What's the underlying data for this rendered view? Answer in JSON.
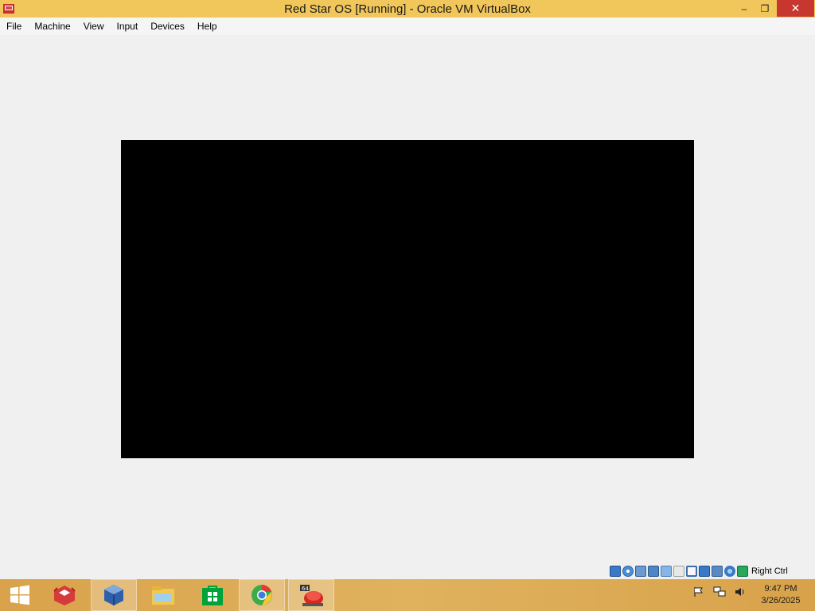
{
  "window": {
    "title": "Red Star OS [Running] - Oracle VM VirtualBox",
    "minimize_label": "–",
    "maximize_label": "❐",
    "close_label": "✕"
  },
  "menu": {
    "items": [
      "File",
      "Machine",
      "View",
      "Input",
      "Devices",
      "Help"
    ]
  },
  "statusbar": {
    "icons": [
      "hard-disk-icon",
      "optical-drive-icon",
      "audio-icon",
      "network-icon",
      "usb-icon",
      "shared-folders-icon",
      "display-icon",
      "video-capture-icon",
      "mouse-integration-icon",
      "cpu-icon",
      "host-key-icon"
    ],
    "host_key": "Right Ctrl"
  },
  "taskbar": {
    "apps": [
      "start-icon",
      "app-icon-red",
      "virtualbox-icon",
      "file-explorer-icon",
      "store-icon",
      "chrome-icon",
      "red-star-vm-icon"
    ],
    "tray_icons": [
      "flag-icon",
      "network-icon",
      "volume-icon"
    ],
    "time": "9:47 PM",
    "date": "3/26/2025"
  },
  "colors": {
    "titlebar": "#f1c65a",
    "close": "#c7372f",
    "taskbar": "#dcaa55",
    "vm_screen": "#000000"
  }
}
